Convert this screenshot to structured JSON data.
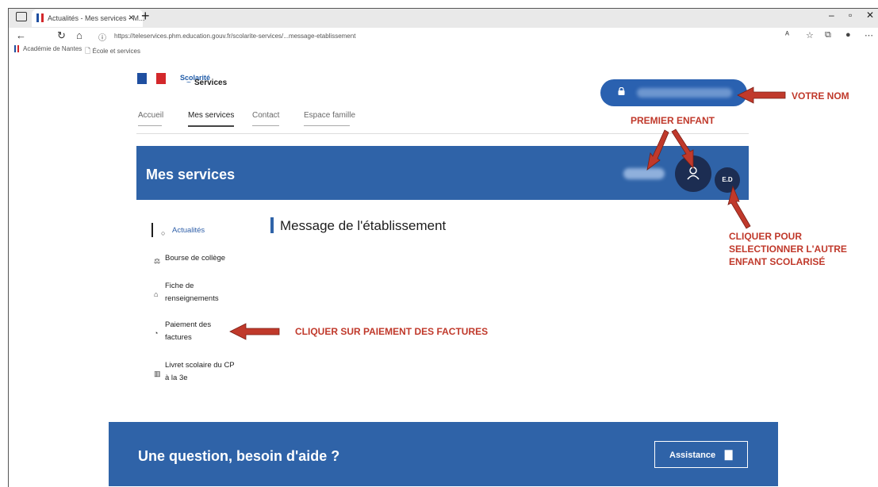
{
  "browser": {
    "tab_title": "Actualités - Mes services - M...",
    "tab_close": "×",
    "new_tab": "+",
    "url": "https://teleservices.phm.education.gouv.fr/scolarite-services/...message-etablissement",
    "bookmarks": [
      "Académie de Nantes",
      "École et services"
    ]
  },
  "header": {
    "brand_line1": "Scolarité",
    "brand_line2": "Services",
    "nav": [
      "Accueil",
      "Mes services",
      "Contact",
      "Espace famille"
    ],
    "active_nav": "Mes services"
  },
  "banner": {
    "title": "Mes services",
    "alt_child_initials": "E.D"
  },
  "sidebar": {
    "items": [
      {
        "label": "Actualités",
        "icon": "circle-icon"
      },
      {
        "label": "Bourse de collège",
        "icon": "scholarship-icon"
      },
      {
        "label": "Fiche de renseignements",
        "icon": "form-icon"
      },
      {
        "label": "Paiement des factures",
        "icon": "payment-icon"
      },
      {
        "label": "Livret scolaire du CP à la 3e",
        "icon": "book-icon"
      }
    ]
  },
  "main": {
    "title": "Message de l'établissement"
  },
  "help": {
    "title": "Une question, besoin d'aide ?",
    "button": "Assistance"
  },
  "annotations": {
    "votre_nom": "VOTRE NOM",
    "premier_enfant": "PREMIER ENFANT",
    "cliquer_autre_l1": "CLIQUER POUR",
    "cliquer_autre_l2": "SELECTIONNER L'AUTRE",
    "cliquer_autre_l3": "ENFANT SCOLARISÉ",
    "cliquer_paiement": "CLIQUER SUR PAIEMENT DES FACTURES"
  },
  "colors": {
    "brand_blue": "#2f63a8",
    "annotation_red": "#c0392b",
    "avatar_dark": "#1c2d52"
  }
}
